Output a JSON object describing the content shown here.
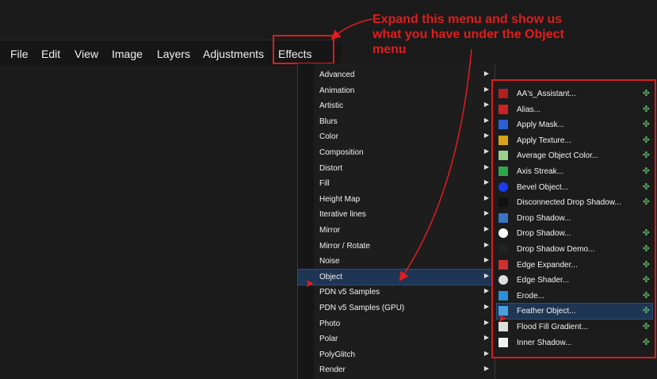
{
  "annotation": "Expand this menu and show us what you have under the Object   menu",
  "menubar": [
    "File",
    "Edit",
    "View",
    "Image",
    "Layers",
    "Adjustments",
    "Effects"
  ],
  "effects_menu": [
    "Advanced",
    "Animation",
    "Artistic",
    "Blurs",
    "Color",
    "Composition",
    "Distort",
    "Fill",
    "Height Map",
    "Iterative lines",
    "Mirror",
    "Mirror / Rotate",
    "Noise",
    "Object",
    "PDN v5 Samples",
    "PDN v5 Samples (GPU)",
    "Photo",
    "Polar",
    "PolyGlitch",
    "Render"
  ],
  "effects_selected": "Object",
  "submenu_arrow": "▶",
  "object_menu": [
    {
      "label": "AA's_Assistant...",
      "icon": "aa-assistant-icon",
      "color": "#b02020",
      "plugin": true
    },
    {
      "label": "Alias...",
      "icon": "alias-icon",
      "color": "#cc2222",
      "plugin": true
    },
    {
      "label": "Apply Mask...",
      "icon": "apply-mask-icon",
      "color": "#2c5fd6",
      "plugin": true
    },
    {
      "label": "Apply Texture...",
      "icon": "apply-texture-icon",
      "color": "#d9a21a",
      "plugin": true
    },
    {
      "label": "Average Object Color...",
      "icon": "average-color-icon",
      "color": "#9ad08a",
      "plugin": true
    },
    {
      "label": "Axis Streak...",
      "icon": "axis-streak-icon",
      "color": "#2fa64a",
      "plugin": true
    },
    {
      "label": "Bevel Object...",
      "icon": "bevel-object-icon",
      "color": "#1c3cf0",
      "plugin": true
    },
    {
      "label": "Disconnected Drop Shadow...",
      "icon": "disconnected-shadow-icon",
      "color": "#111111",
      "plugin": true
    },
    {
      "label": "Drop Shadow...",
      "icon": "drop-shadow-icon",
      "color": "#3a74c4",
      "plugin": false
    },
    {
      "label": "Drop Shadow...",
      "icon": "drop-shadow-2-icon",
      "color": "#ffffff",
      "plugin": true
    },
    {
      "label": "Drop Shadow Demo...",
      "icon": "drop-shadow-demo-icon",
      "color": "#222222",
      "plugin": true
    },
    {
      "label": "Edge Expander...",
      "icon": "edge-expander-icon",
      "color": "#d03030",
      "plugin": true
    },
    {
      "label": "Edge Shader...",
      "icon": "edge-shader-icon",
      "color": "#dddddd",
      "plugin": true
    },
    {
      "label": "Erode...",
      "icon": "erode-icon",
      "color": "#2a8fd6",
      "plugin": true
    },
    {
      "label": "Feather Object...",
      "icon": "feather-object-icon",
      "color": "#4a9fe0",
      "plugin": true
    },
    {
      "label": "Flood Fill Gradient...",
      "icon": "flood-fill-icon",
      "color": "#dddddd",
      "plugin": true
    },
    {
      "label": "Inner Shadow...",
      "icon": "inner-shadow-icon",
      "color": "#f0f0f0",
      "plugin": true
    }
  ],
  "object_selected_index": 14,
  "plugin_glyph": "✤",
  "colors": {
    "annotation": "#e21c1c",
    "selection": "#1e3553",
    "plugin_icon": "#5aa35e"
  }
}
